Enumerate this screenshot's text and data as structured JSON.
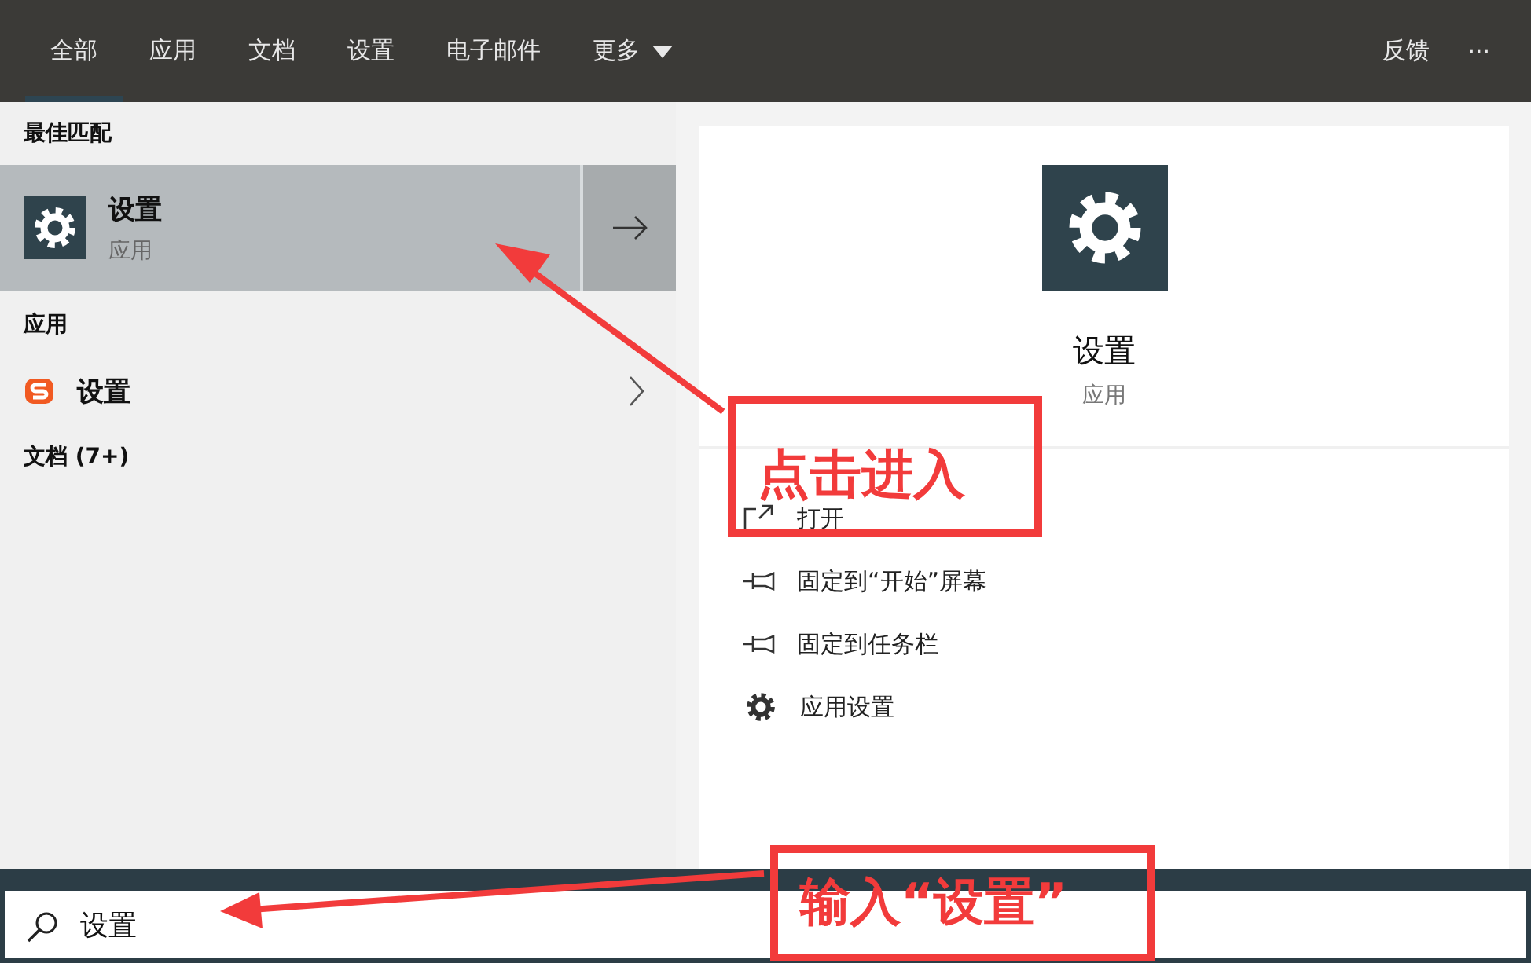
{
  "tabs": [
    {
      "label": "全部",
      "selected": true
    },
    {
      "label": "应用",
      "selected": false
    },
    {
      "label": "文档",
      "selected": false
    },
    {
      "label": "设置",
      "selected": false
    },
    {
      "label": "电子邮件",
      "selected": false
    },
    {
      "label": "更多",
      "selected": false,
      "kind": "dropdown"
    }
  ],
  "feedback": "反馈",
  "more_button": "···",
  "best_match": {
    "heading": "最佳匹配",
    "item": {
      "title": "设置",
      "subtitle": "应用",
      "selected": true
    }
  },
  "apps": {
    "heading": "应用",
    "items": [
      {
        "title": "设置"
      }
    ]
  },
  "documents": {
    "heading": "文档 (7+)"
  },
  "preview": {
    "title": "设置",
    "subtitle": "应用",
    "actions": [
      {
        "kind": "open",
        "label": "打开"
      },
      {
        "kind": "pin",
        "label": "固定到“开始”屏幕"
      },
      {
        "kind": "pin",
        "label": "固定到任务栏"
      },
      {
        "kind": "gear",
        "label": "应用设置"
      }
    ]
  },
  "search": {
    "value": "设置"
  },
  "annotations": [
    {
      "text": "点击进入"
    },
    {
      "text": "输入“设置”"
    }
  ]
}
